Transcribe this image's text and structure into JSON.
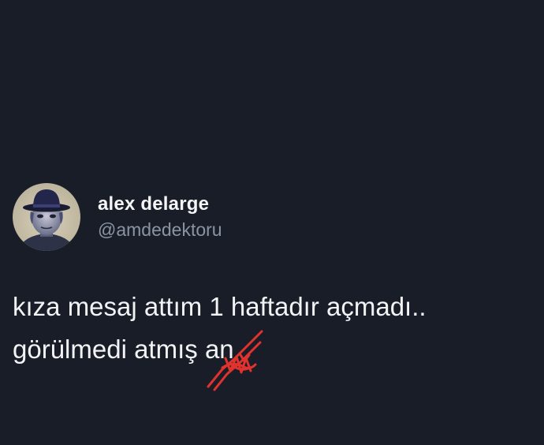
{
  "tweet": {
    "author": {
      "display_name": "alex delarge",
      "handle": "@amdedektoru"
    },
    "text_line_1": "kıza mesaj attım 1 haftadır açmadı..",
    "text_line_2_prefix": "görülmedi atmış ",
    "text_line_2_censored": "an",
    "censor_color": "#e0332e"
  }
}
